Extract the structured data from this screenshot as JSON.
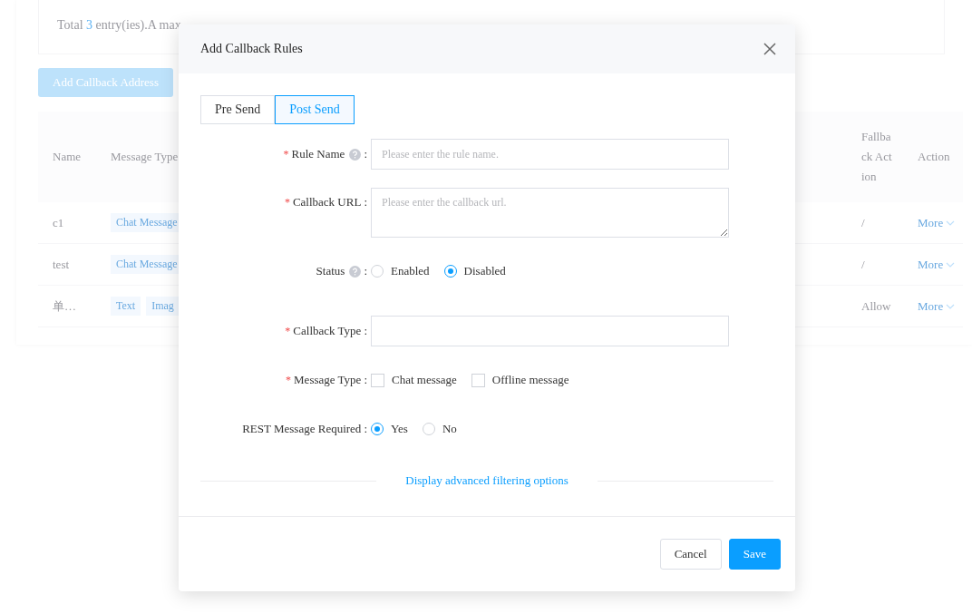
{
  "page": {
    "summary": {
      "prefix": "Total ",
      "count": "3",
      "suffix": " entry(ies).A max"
    },
    "add_button": "Add Callback Address",
    "table": {
      "columns": [
        "Name",
        "Message Type",
        "Fallback Action",
        "Action"
      ],
      "rows": [
        {
          "name": "c1",
          "tags": [
            "Chat Message"
          ],
          "fallback": "/",
          "action": "More"
        },
        {
          "name": "test",
          "tags": [
            "Chat Message"
          ],
          "fallback": "/",
          "action": "More"
        },
        {
          "name": "单…",
          "tags": [
            "Text",
            "Imag"
          ],
          "fallback": "Allow",
          "action": "More"
        }
      ]
    }
  },
  "dialog": {
    "title": "Add Callback Rules",
    "tabs": [
      {
        "label": "Pre Send",
        "selected": false
      },
      {
        "label": "Post Send",
        "selected": true
      }
    ],
    "fields": [
      {
        "kind": "input",
        "required_mark": "*",
        "label": "Rule Name",
        "help": true,
        "colon": ":",
        "placeholder": "Please enter the rule name."
      },
      {
        "kind": "textarea",
        "required_mark": "*",
        "label": "Callback URL",
        "help": false,
        "colon": ":",
        "placeholder": "Please enter the callback url."
      },
      {
        "kind": "radio",
        "label": "Status",
        "help": true,
        "colon": ":",
        "options": [
          {
            "label": "Enabled",
            "selected": false
          },
          {
            "label": "Disabled",
            "selected": true
          }
        ]
      },
      {
        "kind": "input",
        "required_mark": "*",
        "label": "Callback Type",
        "help": false,
        "colon": ":"
      },
      {
        "kind": "checkbox",
        "required_mark": "*",
        "label": "Message Type",
        "help": false,
        "colon": ":",
        "options": [
          {
            "label": "Chat message",
            "checked": false
          },
          {
            "label": "Offline message",
            "checked": false
          }
        ]
      },
      {
        "kind": "radio",
        "label": "REST Message Required",
        "help": false,
        "colon": ":",
        "options": [
          {
            "label": "Yes",
            "selected": true
          },
          {
            "label": "No",
            "selected": false
          }
        ]
      }
    ],
    "advanced_link": "Display advanced filtering options",
    "buttons": [
      {
        "label": "Cancel",
        "kind": "default"
      },
      {
        "label": "Save",
        "kind": "primary"
      }
    ]
  }
}
